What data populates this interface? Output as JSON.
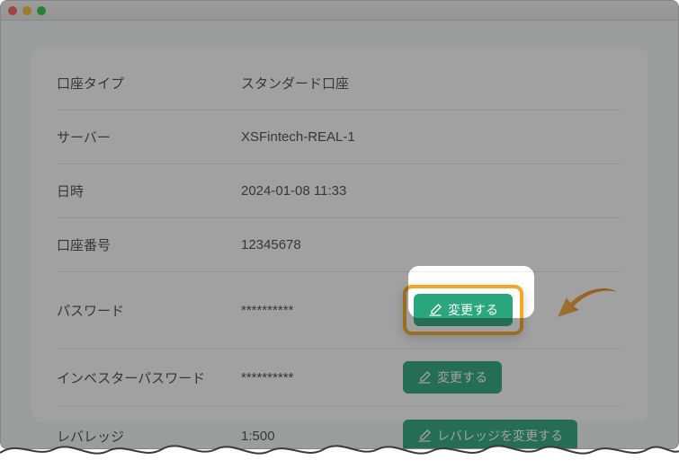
{
  "rows": {
    "account_type": {
      "label": "口座タイプ",
      "value": "スタンダード口座"
    },
    "server": {
      "label": "サーバー",
      "value": "XSFintech-REAL-1"
    },
    "datetime": {
      "label": "日時",
      "value": "2024-01-08 11:33"
    },
    "account_number": {
      "label": "口座番号",
      "value": "12345678"
    },
    "password": {
      "label": "パスワード",
      "value": "**********",
      "button": "変更する"
    },
    "investor_pwd": {
      "label": "インベスターパスワード",
      "value": "**********",
      "button": "変更する"
    },
    "leverage": {
      "label": "レバレッジ",
      "value": "1:500",
      "button": "レバレッジを変更する"
    }
  },
  "colors": {
    "button_bg": "#2aa77c",
    "highlight_border": "#f5a623"
  }
}
